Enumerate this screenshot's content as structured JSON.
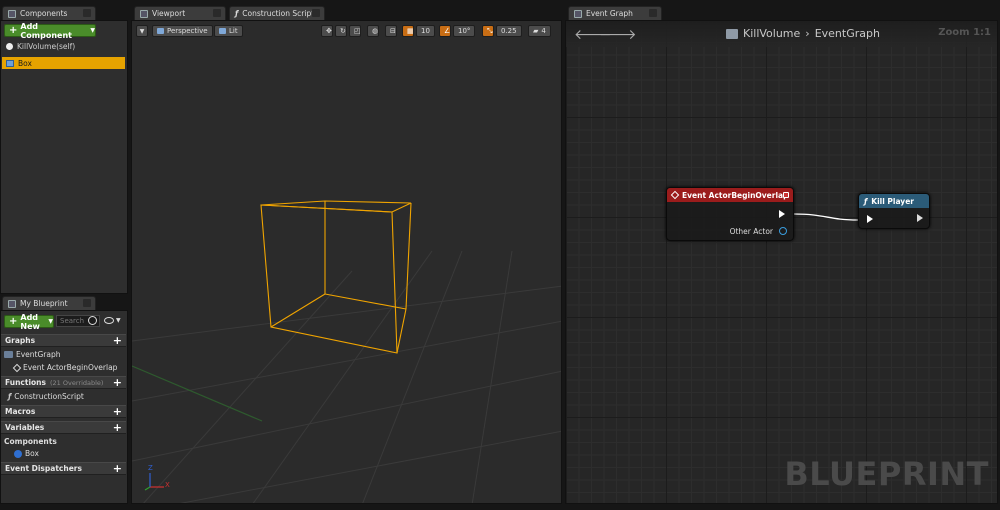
{
  "components": {
    "tab": "Components",
    "add_button": "Add Component",
    "root": "KillVolume(self)",
    "selected": "Box"
  },
  "my_blueprint": {
    "tab": "My Blueprint",
    "add_new": "Add New",
    "search_placeholder": "Search",
    "sections": {
      "graphs": "Graphs",
      "functions": "Functions",
      "functions_note": "(21 Overridable)",
      "macros": "Macros",
      "variables": "Variables",
      "dispatchers": "Event Dispatchers"
    },
    "items": {
      "event_graph": "EventGraph",
      "event_overlap": "Event ActorBeginOverlap",
      "construction": "ConstructionScript",
      "components_cat": "Components",
      "box_var": "Box"
    }
  },
  "viewport": {
    "tab": "Viewport",
    "construction_tab": "Construction Script",
    "perspective": "Perspective",
    "lit": "Lit",
    "grid_snap": "10",
    "rot_snap": "10°",
    "scale_snap": "0.25",
    "camera_speed": "4",
    "axis": {
      "x": "X",
      "z": "Z"
    }
  },
  "event_graph": {
    "tab": "Event Graph",
    "breadcrumb_blueprint": "KillVolume",
    "breadcrumb_graph": "EventGraph",
    "zoom": "Zoom 1:1",
    "watermark": "BLUEPRINT",
    "node_event": {
      "title": "Event ActorBeginOverlap",
      "pin_other": "Other Actor",
      "color": "#9b1c1c"
    },
    "node_call": {
      "title": "Kill Player",
      "color": "#2b5b78"
    }
  }
}
